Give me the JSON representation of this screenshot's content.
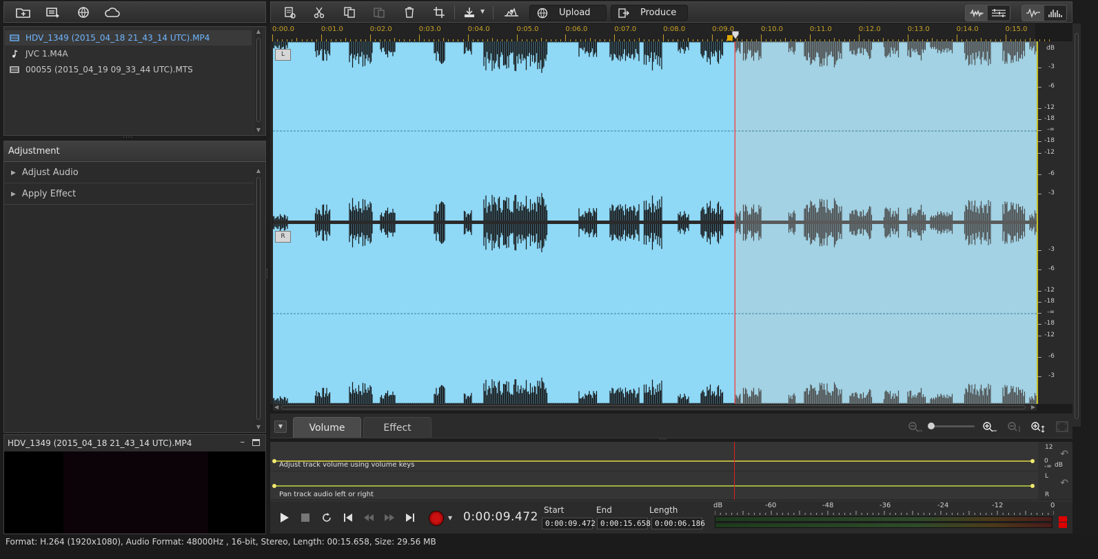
{
  "left_toolbar": {
    "icons": [
      "import-folder-icon",
      "import-files-icon",
      "globe-refresh-icon",
      "cloud-icon"
    ]
  },
  "media_library": {
    "items": [
      {
        "label": "HDV_1349 (2015_04_18 21_43_14 UTC).MP4",
        "icon": "video-icon",
        "selected": true
      },
      {
        "label": "JVC 1.M4A",
        "icon": "music-note-icon",
        "selected": false
      },
      {
        "label": "00055 (2015_04_19 09_33_44 UTC).MTS",
        "icon": "video-icon",
        "selected": false
      }
    ]
  },
  "adjustment": {
    "title": "Adjustment",
    "rows": [
      {
        "label": "Adjust Audio"
      },
      {
        "label": "Apply Effect"
      }
    ]
  },
  "preview": {
    "title": "HDV_1349 (2015_04_18 21_43_14 UTC).MP4",
    "minimize": "–"
  },
  "status": {
    "text": "Format: H.264 (1920x1080), Audio Format: 48000Hz , 16-bit, Stereo, Length: 00:15.658, Size: 29.56 MB"
  },
  "main_toolbar": {
    "upload_label": "Upload",
    "produce_label": "Produce",
    "icons": [
      "properties-icon",
      "scissors-icon",
      "copy-icon",
      "paste-icon",
      "delete-icon",
      "crop-icon",
      "export-icon",
      "noise-icon"
    ]
  },
  "ruler": {
    "labels": [
      "0:00.0",
      "0:01.0",
      "0:02.0",
      "0:03.0",
      "0:04.0",
      "0:05.0",
      "0:06.0",
      "0:07.0",
      "0:08.0",
      "0:09.0",
      "0:10.0",
      "0:11.0",
      "0:12.0",
      "0:13.0",
      "0:14.0",
      "0:15.0"
    ]
  },
  "waveform": {
    "duration_s": 15.658,
    "playhead_s": 9.472,
    "channel_labels": [
      "L",
      "R"
    ],
    "colors": {
      "played_bg": "#8fd8f6",
      "unplayed_bg": "#a2d2e4",
      "played_wave": "#111111",
      "unplayed_wave": "#4a4a4a",
      "playhead": "#ff2a2a"
    }
  },
  "db_scale": {
    "unit": "dB",
    "labels": [
      "-3",
      "-6",
      "-12",
      "-18",
      "-∞",
      "-18",
      "-12",
      "-6",
      "-3",
      "-3",
      "-6",
      "-12",
      "-18",
      "-∞",
      "-18",
      "-12",
      "-6",
      "-3"
    ]
  },
  "tabs": [
    {
      "label": "Volume",
      "active": true
    },
    {
      "label": "Effect",
      "active": false
    }
  ],
  "tracks": {
    "volume_caption": "Adjust track volume using volume keys",
    "pan_caption": "Pan track audio left or right",
    "volume_side": {
      "top": "12",
      "mid": "0",
      "bottom": "-∞",
      "unit": "dB"
    },
    "pan_side": {
      "top": "L",
      "bottom": "R"
    }
  },
  "transport": {
    "timecode": "0:00:09.472",
    "start_label": "Start",
    "end_label": "End",
    "length_label": "Length",
    "start_value": "0:00:09.472",
    "end_value": "0:00:15.658",
    "length_value": "0:00:06.186"
  },
  "meter": {
    "labels": [
      "dB",
      "-60",
      "-48",
      "-36",
      "-24",
      "-12",
      "0"
    ]
  }
}
